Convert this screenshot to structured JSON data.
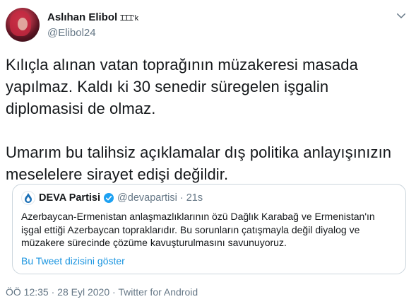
{
  "author": {
    "display_name": "Aslıhan Elibol",
    "name_extra": "ꞮꞮꞮ'k",
    "handle": "@Elibol24"
  },
  "tweet": {
    "line1": "Kılıçla alınan vatan toprağının müzakeresi masada",
    "line2": "yapılmaz. Kaldı ki 30 senedir süregelen işgalin",
    "line3": "diplomasisi de olmaz.",
    "line4": "Umarım bu talihsiz açıklamalar dış politika anlayışınızın",
    "line5": "meselelere sirayet edişi değildir."
  },
  "quoted": {
    "name": "DEVA Partisi",
    "handle": "@devapartisi",
    "separator": "·",
    "time": "21s",
    "line1": "Azerbaycan-Ermenistan anlaşmazlıklarının özü Dağlık Karabağ ve Ermenistan'ın",
    "line2": "işgal ettiği Azerbaycan topraklarıdır. Bu sorunların çatışmayla değil diyalog ve",
    "line3": "müzakere sürecinde çözüme kavuşturulmasını savunuyoruz.",
    "thread_link": "Bu Tweet dizisini göster"
  },
  "meta": {
    "time": "ÖÖ 12:35",
    "sep1": " · ",
    "date": "28 Eyl 2020",
    "sep2": " · ",
    "source": "Twitter for Android"
  },
  "colors": {
    "text": "#14171a",
    "secondary": "#657786",
    "link": "#1b95e0",
    "border": "#ccd6dd",
    "verified": "#1da1f2",
    "deva_blue": "#1a6fb5"
  },
  "icons": {
    "menu": "chevron-down-icon",
    "verified": "verified-badge-icon",
    "logo": "deva-logo-icon"
  }
}
